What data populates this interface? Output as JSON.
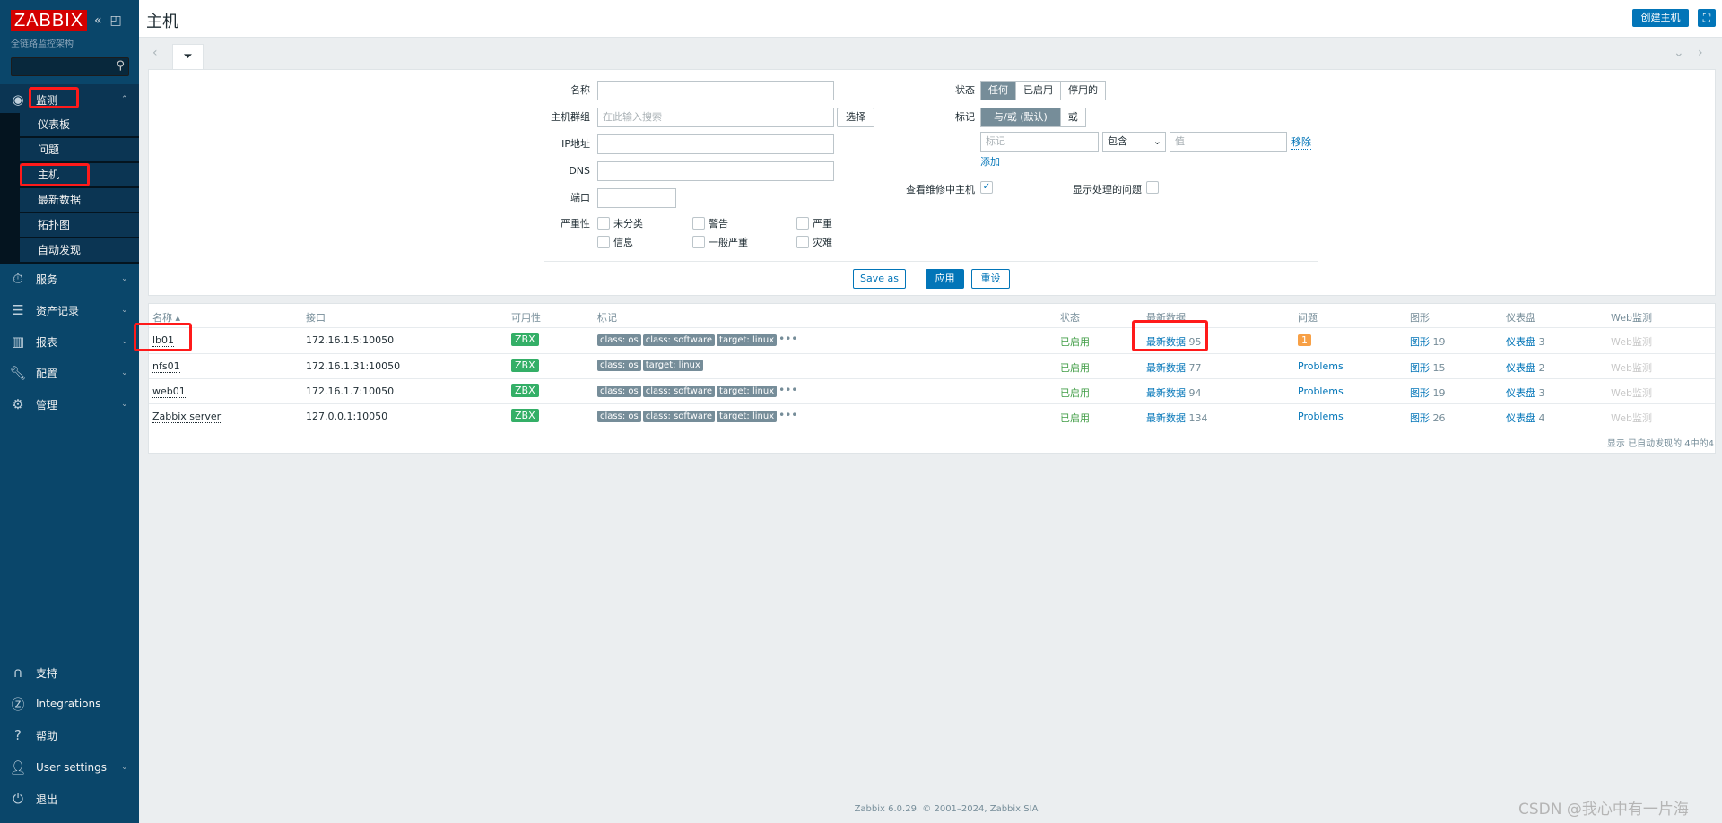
{
  "sidebar": {
    "logo": "ZABBIX",
    "subtitle": "全链路监控架构",
    "monitoring": {
      "label": "监测",
      "items": [
        "仪表板",
        "问题",
        "主机",
        "最新数据",
        "拓扑图",
        "自动发现"
      ]
    },
    "menus": [
      {
        "label": "服务",
        "icon": "stopwatch-icon"
      },
      {
        "label": "资产记录",
        "icon": "list-icon"
      },
      {
        "label": "报表",
        "icon": "chart-icon"
      },
      {
        "label": "配置",
        "icon": "wrench-icon"
      },
      {
        "label": "管理",
        "icon": "gear-icon"
      }
    ],
    "bottom": [
      {
        "label": "支持",
        "icon": "headset-icon"
      },
      {
        "label": "Integrations",
        "icon": "zabbix-z-icon"
      },
      {
        "label": "帮助",
        "icon": "question-icon"
      },
      {
        "label": "User settings",
        "icon": "user-icon"
      },
      {
        "label": "退出",
        "icon": "power-icon"
      }
    ]
  },
  "header": {
    "title": "主机",
    "create_button": "创建主机"
  },
  "filter": {
    "name_label": "名称",
    "hostgroup_label": "主机群组",
    "hostgroup_placeholder": "在此输入搜索",
    "select_button": "选择",
    "ip_label": "IP地址",
    "dns_label": "DNS",
    "port_label": "端口",
    "severity_label": "严重性",
    "severities": [
      "未分类",
      "警告",
      "严重",
      "信息",
      "一般严重",
      "灾难"
    ],
    "status_label": "状态",
    "status_options": [
      "任何",
      "已启用",
      "停用的"
    ],
    "status_selected": "任何",
    "tags_label": "标记",
    "tag_mode_options": [
      "与/或 (默认)",
      "或"
    ],
    "tag_placeholder": "标记",
    "tag_operator": "包含",
    "value_placeholder": "值",
    "remove_link": "移除",
    "add_link": "添加",
    "maintenance_label": "查看维修中主机",
    "maintenance_checked": true,
    "suppressed_label": "显示处理的问题",
    "suppressed_checked": false,
    "save_as": "Save as",
    "apply": "应用",
    "reset": "重设"
  },
  "table": {
    "columns": [
      "名称 ▴",
      "接口",
      "可用性",
      "标记",
      "状态",
      "最新数据",
      "问题",
      "图形",
      "仪表盘",
      "Web监测"
    ],
    "rows": [
      {
        "name": "lb01",
        "interface": "172.16.1.5:10050",
        "availability": "ZBX",
        "tags": [
          "class: os",
          "class: software",
          "target: linux"
        ],
        "more": true,
        "status": "已启用",
        "latest": "最新数据",
        "latest_count": "95",
        "problems": "1",
        "graphs": "图形",
        "graphs_count": "19",
        "dash": "仪表盘",
        "dash_count": "3",
        "web": "Web监测"
      },
      {
        "name": "nfs01",
        "interface": "172.16.1.31:10050",
        "availability": "ZBX",
        "tags": [
          "class: os",
          "target: linux"
        ],
        "more": false,
        "status": "已启用",
        "latest": "最新数据",
        "latest_count": "77",
        "problems": "Problems",
        "graphs": "图形",
        "graphs_count": "15",
        "dash": "仪表盘",
        "dash_count": "2",
        "web": "Web监测"
      },
      {
        "name": "web01",
        "interface": "172.16.1.7:10050",
        "availability": "ZBX",
        "tags": [
          "class: os",
          "class: software",
          "target: linux"
        ],
        "more": true,
        "status": "已启用",
        "latest": "最新数据",
        "latest_count": "94",
        "problems": "Problems",
        "graphs": "图形",
        "graphs_count": "19",
        "dash": "仪表盘",
        "dash_count": "3",
        "web": "Web监测"
      },
      {
        "name": "Zabbix server",
        "interface": "127.0.0.1:10050",
        "availability": "ZBX",
        "tags": [
          "class: os",
          "class: software",
          "target: linux"
        ],
        "more": true,
        "status": "已启用",
        "latest": "最新数据",
        "latest_count": "134",
        "problems": "Problems",
        "graphs": "图形",
        "graphs_count": "26",
        "dash": "仪表盘",
        "dash_count": "4",
        "web": "Web监测"
      }
    ],
    "summary": "显示 已自动发现的 4中的4"
  },
  "footer": "Zabbix 6.0.29. © 2001–2024, Zabbix SIA",
  "watermark": "CSDN @我心中有一片海",
  "colors": {
    "sidebar": "#0a466a",
    "accent": "#0275b8",
    "enabled": "#429e47",
    "zbx": "#34af67",
    "problem_badge": "#f7a046",
    "annotation": "#ff1a1a"
  }
}
